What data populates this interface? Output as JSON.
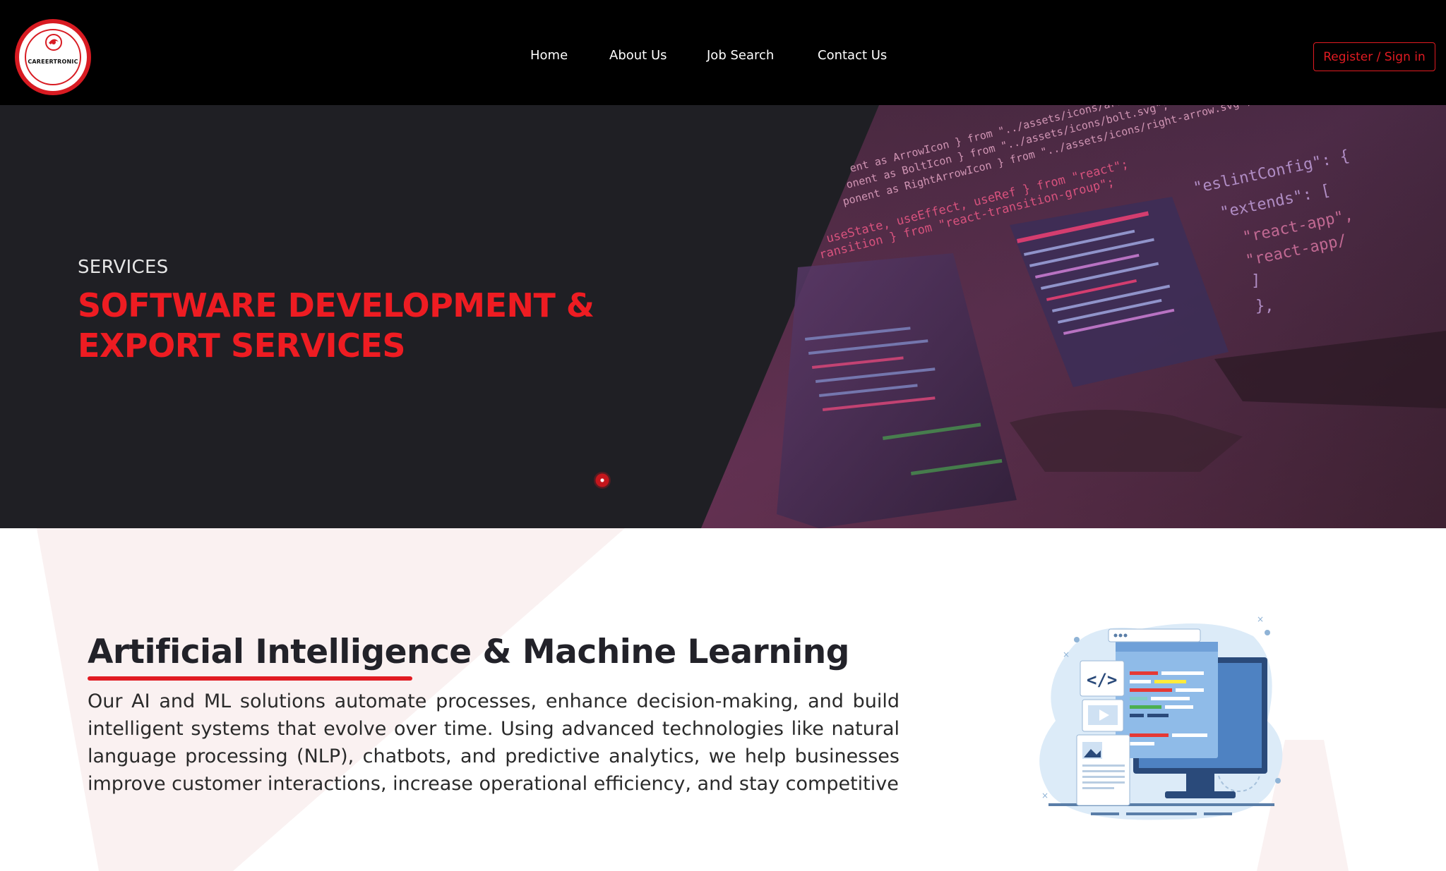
{
  "brand": {
    "name": "CAREERTRONIC",
    "accent_color": "#e11b22",
    "logo_border_color": "#d81b22"
  },
  "nav": {
    "items": [
      {
        "label": "Home"
      },
      {
        "label": "About Us"
      },
      {
        "label": "Job Search"
      },
      {
        "label": "Contact Us"
      }
    ],
    "register_label": "Register / Sign in"
  },
  "hero": {
    "label": "SERVICES",
    "title": "SOFTWARE DEVELOPMENT & EXPORT SERVICES",
    "background_color": "#1f1f24",
    "title_color": "#ee1c22",
    "image_code_lines": [
      "ent as ArrowIcon } from \"../assets/icons/arrow.svg\";",
      "onent as BoltIcon } from \"../assets/icons/bolt.svg\";",
      "ponent as RightArrowIcon } from \"../assets/icons/right-arrow.svg\";",
      "useState, useEffect, useRef } from \"react\";",
      "ransition } from \"react-transition-group\";",
      "\"eslintConfig\": {",
      "\"extends\": [",
      "\"react-app\",",
      "\"react-app/",
      "]",
      "},"
    ]
  },
  "section": {
    "title": "Artificial Intelligence & Machine Learning",
    "body": "Our AI and ML solutions automate processes, enhance decision-making, and build intelligent systems that evolve over time. Using advanced technologies like natural language processing (NLP), chatbots, and predictive analytics, we help businesses improve customer interactions, increase operational efficiency, and stay competitive",
    "illustration_icon": "web-development-illustration-icon"
  }
}
